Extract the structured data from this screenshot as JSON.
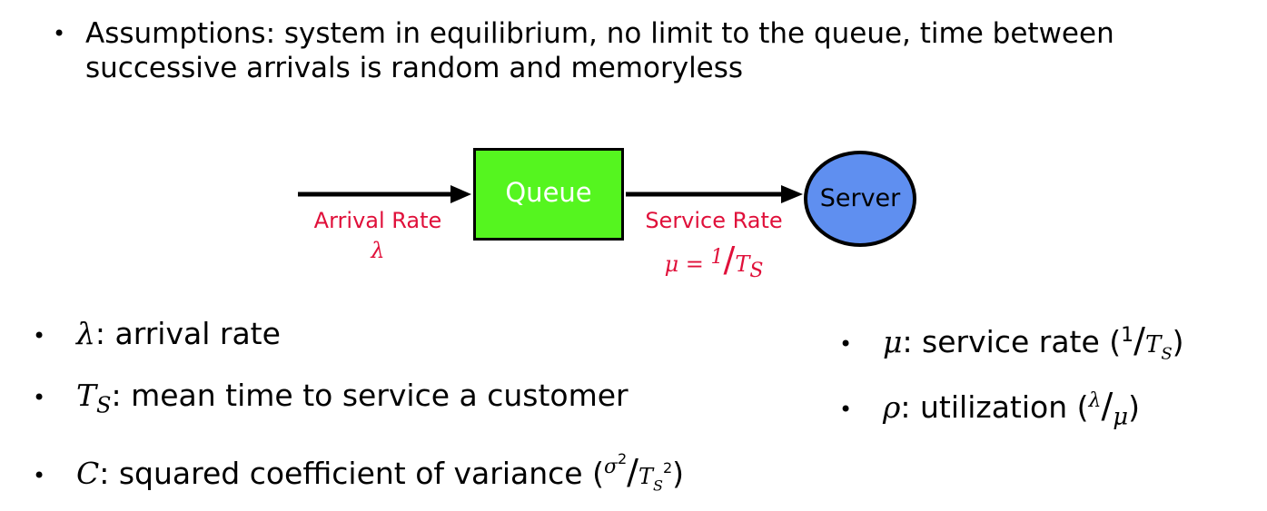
{
  "intro": {
    "bullet": "•",
    "text": "Assumptions: system in equilibrium, no limit to the queue, time between successive arrivals is random and memoryless"
  },
  "diagram": {
    "queue_label": "Queue",
    "server_label": "Server",
    "arrival_label": "Arrival Rate",
    "arrival_symbol": "λ",
    "service_label": "Service Rate",
    "service_formula": {
      "lhs": "μ = ",
      "num": "1",
      "den": "T",
      "den_sub": "S"
    },
    "colors": {
      "queue": "#55f51f",
      "server": "#5f8ff0",
      "label": "#e0103a"
    }
  },
  "bullets": {
    "lambda": {
      "sym": "λ",
      "text": ": arrival rate"
    },
    "ts": {
      "sym": "T",
      "sub": "S",
      "text": ": mean time to service a customer"
    },
    "c": {
      "sym": "C",
      "text": ": squared coefficient of variance (",
      "num": "σ",
      "num_sup": "2",
      "den": "T",
      "den_sub": "S",
      "den_sup": "2",
      "close": ")"
    },
    "mu": {
      "sym": "μ",
      "text": ": service rate (",
      "num": "1",
      "den": "T",
      "den_sub": "S",
      "close": ")"
    },
    "rho": {
      "sym": "ρ",
      "text": ": utilization (",
      "num": "λ",
      "den": "μ",
      "close": ")"
    }
  }
}
